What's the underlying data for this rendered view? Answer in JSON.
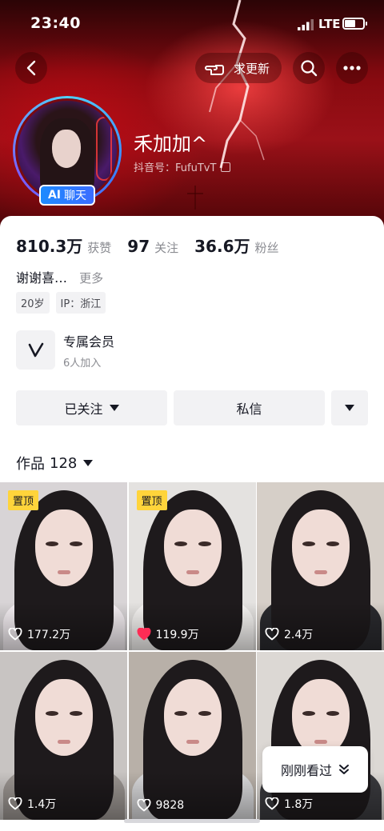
{
  "status_bar": {
    "time": "23:40",
    "network": "LTE",
    "icons": [
      "signal-icon",
      "battery-icon"
    ]
  },
  "top_bar": {
    "update_label": "求更新",
    "icons": [
      "back-icon",
      "hand-icon",
      "search-icon",
      "more-icon"
    ]
  },
  "profile": {
    "nickname": "禾加加^",
    "douyin_id": "抖音号：FufuTvT",
    "ai_chip": {
      "prefix": "AI",
      "label": "聊天"
    }
  },
  "stats": [
    {
      "num": "810.3万",
      "label": "获赞"
    },
    {
      "num": "97",
      "label": "关注"
    },
    {
      "num": "36.6万",
      "label": "粉丝"
    }
  ],
  "bio": {
    "text": "谢谢喜…",
    "more": "更多"
  },
  "tags": [
    "20岁",
    "IP：浙江"
  ],
  "membership": {
    "title": "专属会员",
    "subtitle": "6人加入"
  },
  "actions": {
    "follow": "已关注",
    "message": "私信"
  },
  "works": {
    "label": "作品",
    "count": "128"
  },
  "colors": {
    "accent_red": "#fe2c55",
    "pin_yellow": "#ffd43b",
    "banner_red": "#a5121a"
  },
  "videos": [
    {
      "pinned": true,
      "pin_label": "置顶",
      "likes": "177.2万",
      "liked": false,
      "bg": "#d8d4d6",
      "body": "#f4eef2"
    },
    {
      "pinned": true,
      "pin_label": "置顶",
      "likes": "119.9万",
      "liked": true,
      "bg": "#e4e2e0",
      "body": "#f6f4f2"
    },
    {
      "pinned": false,
      "pin_label": "",
      "likes": "2.4万",
      "liked": false,
      "bg": "#d6cfc8",
      "body": "#2a2a2e"
    },
    {
      "pinned": false,
      "pin_label": "",
      "likes": "1.4万",
      "liked": false,
      "bg": "#c8c4c2",
      "body": "#9a9490"
    },
    {
      "pinned": false,
      "pin_label": "",
      "likes": "9828",
      "liked": false,
      "bg": "#b8b0a8",
      "body": "#d8d8da"
    },
    {
      "pinned": false,
      "pin_label": "",
      "likes": "1.8万",
      "liked": false,
      "bg": "#dcd8d4",
      "body": "#3a3a3e"
    }
  ],
  "recently_viewed": "刚刚看过"
}
